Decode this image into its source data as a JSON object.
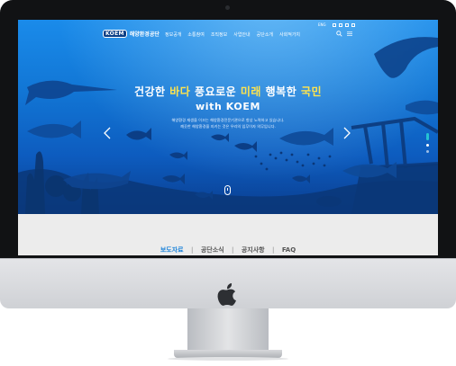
{
  "header": {
    "logo_mark": "KOEM",
    "logo_text": "해양환경공단",
    "nav": [
      "정보공개",
      "소통참여",
      "조직정보",
      "사업안내",
      "공단소개",
      "사회적가치"
    ],
    "lang": "ENG"
  },
  "hero": {
    "title_parts": [
      "건강한 ",
      "바다",
      " 풍요로운 ",
      "미래",
      " 행복한 ",
      "국민"
    ],
    "subtitle": "with KOEM",
    "desc_line1": "해양환경 재생을 이끄는 해양환경전문기관으로 항상 노력하고 있습니다.",
    "desc_line2": "깨끗한 해양환경을 지키는 것은 우리의 임무이자 의무입니다.",
    "highlight_color": "#ffe44d"
  },
  "tabs": {
    "items": [
      "보도자료",
      "공단소식",
      "공지사항",
      "FAQ"
    ],
    "separator": "|",
    "active_color": "#1a82d9"
  }
}
